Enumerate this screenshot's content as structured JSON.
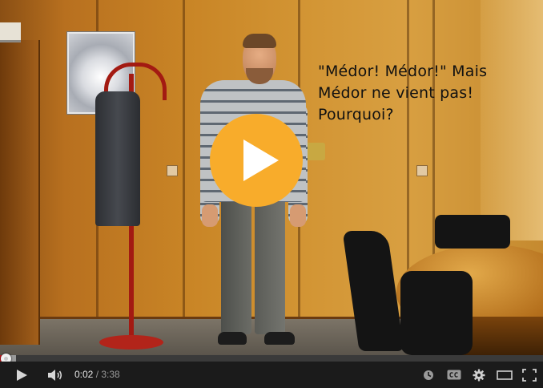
{
  "video": {
    "caption_lines": [
      "\"Médor! Médor!\" Mais",
      "Médor ne vient pas!",
      "Pourquoi?"
    ],
    "play_button_color": "#f8ac2b"
  },
  "player": {
    "progress_played_fraction": 0.0105,
    "progress_buffered_fraction": 0.03,
    "progress_color": "#cc181e",
    "current_time": "0:02",
    "time_separator": " / ",
    "duration": "3:38"
  },
  "controls": {
    "icons": [
      "play-icon",
      "volume-icon",
      "clock-icon",
      "captions-icon",
      "settings-gear-icon",
      "theater-mode-icon",
      "fullscreen-icon"
    ]
  }
}
